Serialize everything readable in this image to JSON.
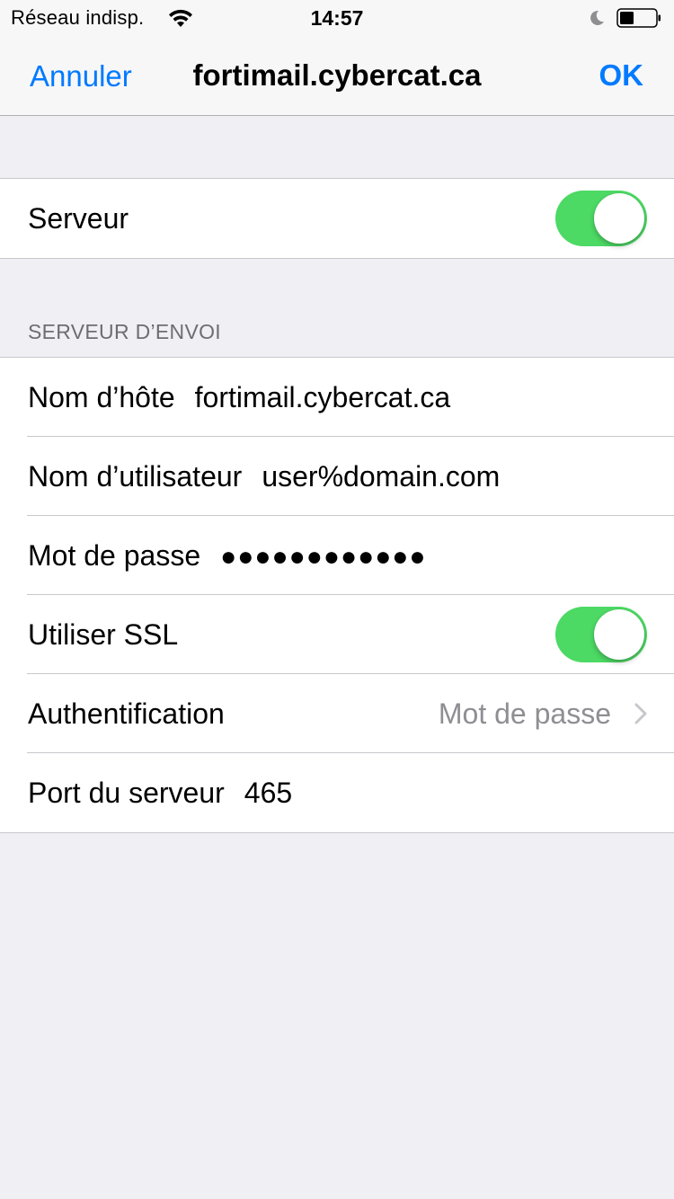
{
  "status_bar": {
    "carrier": "Réseau indisp.",
    "time": "14:57",
    "wifi_icon": "wifi-icon",
    "moon_icon": "moon-icon",
    "battery_icon": "battery-icon"
  },
  "nav": {
    "cancel_label": "Annuler",
    "title": "fortimail.cybercat.ca",
    "ok_label": "OK"
  },
  "server_toggle": {
    "label": "Serveur",
    "on": true
  },
  "outgoing": {
    "header": "SERVEUR D’ENVOI",
    "rows": [
      {
        "label": "Nom d’hôte",
        "value": "fortimail.cybercat.ca"
      },
      {
        "label": "Nom d’utilisateur",
        "value": "user%domain.com"
      },
      {
        "label": "Mot de passe",
        "value": "●●●●●●●●●●●●"
      },
      {
        "label": "Utiliser SSL",
        "toggle_on": true
      },
      {
        "label": "Authentification",
        "value": "Mot de passe"
      },
      {
        "label": "Port du serveur",
        "value": "465"
      }
    ]
  },
  "colors": {
    "accent": "#007aff",
    "toggle_on": "#4cd964",
    "background": "#efeff4",
    "secondary_text": "#8e8e93"
  }
}
